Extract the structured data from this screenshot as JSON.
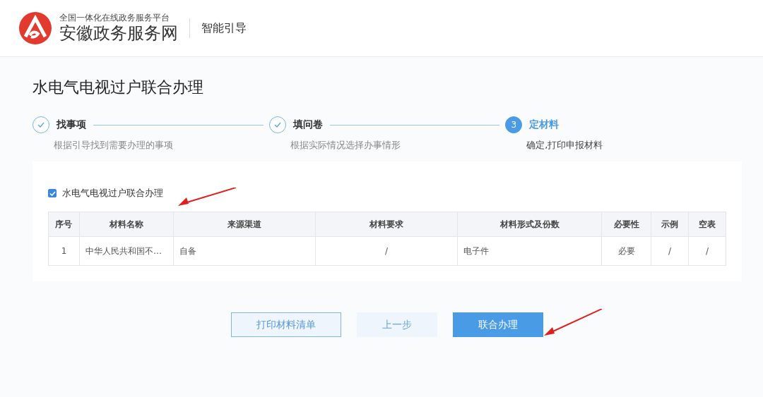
{
  "header": {
    "platform": "全国一体化在线政务服务平台",
    "site_name": "安徽政务服务网",
    "section": "智能引导"
  },
  "page_title": "水电气电视过户联合办理",
  "steps": [
    {
      "done": true,
      "title": "找事项",
      "description": "根据引导找到需要办理的事项"
    },
    {
      "done": true,
      "title": "填问卷",
      "description": "根据实际情况选择办事情形"
    },
    {
      "done": false,
      "number": "3",
      "title": "定材料",
      "description": "确定,打印申报材料"
    }
  ],
  "item": {
    "label": "水电气电视过户联合办理",
    "checked": true
  },
  "table": {
    "columns": [
      "序号",
      "材料名称",
      "来源渠道",
      "材料要求",
      "材料形式及份数",
      "必要性",
      "示例",
      "空表"
    ],
    "rows": [
      [
        "1",
        "中华人民共和国不…",
        "自备",
        "/",
        "电子件",
        "必要",
        "/",
        "/"
      ]
    ]
  },
  "buttons": [
    {
      "label": "打印材料清单",
      "kind": "outline"
    },
    {
      "label": "上一步",
      "kind": "light"
    },
    {
      "label": "联合办理",
      "kind": "primary"
    }
  ],
  "annotations": [
    {
      "kind": "arrow"
    },
    {
      "kind": "arrow"
    }
  ]
}
